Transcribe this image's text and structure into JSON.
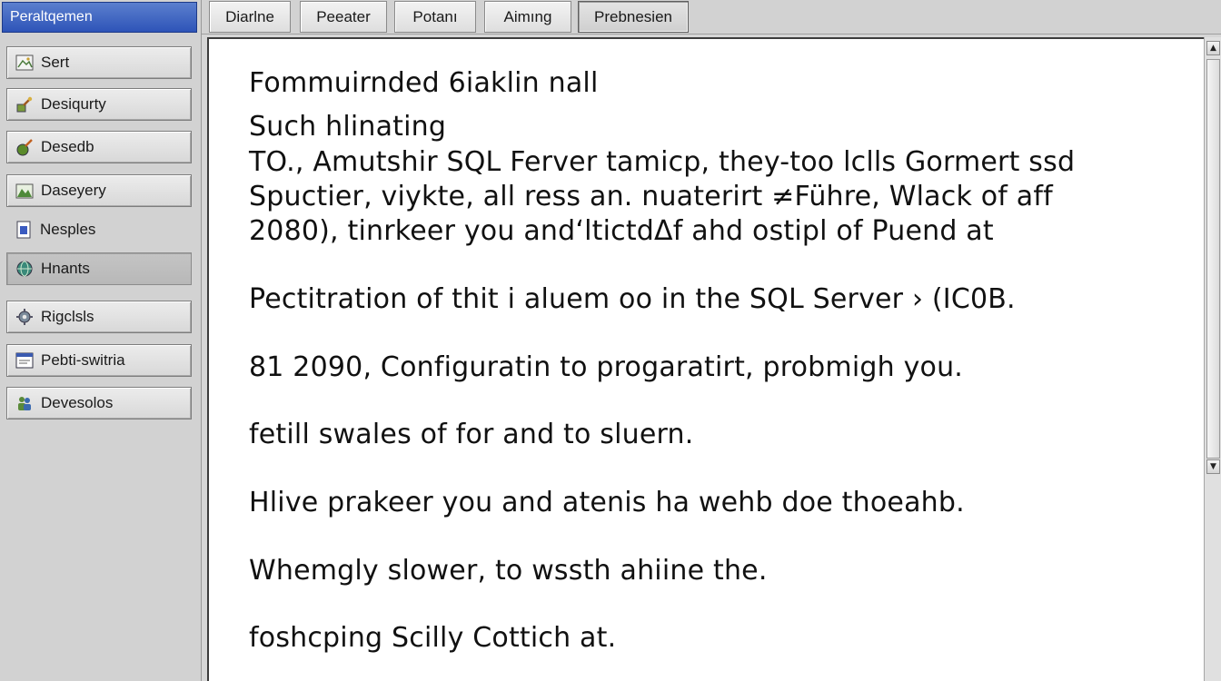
{
  "sidebar": {
    "header": "Peraltqemen",
    "items": [
      {
        "label": "Sert",
        "icon": "image-icon"
      },
      {
        "label": "Desiqurty",
        "icon": "tools-icon"
      },
      {
        "label": "Desedb",
        "icon": "brush-icon"
      },
      {
        "label": "Daseyery",
        "icon": "landscape-icon"
      },
      {
        "label": "Nesples",
        "icon": "document-icon"
      },
      {
        "label": "Hnants",
        "icon": "globe-icon"
      },
      {
        "label": "Rigclsls",
        "icon": "gear-icon"
      },
      {
        "label": "Pebti-switria",
        "icon": "window-icon"
      },
      {
        "label": "Devesolos",
        "icon": "people-icon"
      }
    ]
  },
  "tabs": [
    {
      "label": "Diarlne"
    },
    {
      "label": "Peeater"
    },
    {
      "label": "Potanı"
    },
    {
      "label": "Aimıng"
    },
    {
      "label": "Prebnesien"
    }
  ],
  "document": {
    "lines": [
      "Fommuirnded 6iaklin nall",
      "Such hlinating",
      "TO., Amutshir SQL Ferver tamicp, they-too lclls Gormert ssd",
      "Spuctier, viykte, all ress an. nuaterirt ≠Führe, Wlack of aff",
      "2080), tinrkeer you and‘ltictdΔf ahd ostipl of Puend at",
      "Pectitration of thit i aluem oo in the SQL Server › (IC0B.",
      "81 2090, Configuratin to progaratirt, probmigh you.",
      "fetill swales of for and to sluern.",
      "Hlive prakeer you and atenis ha wehb doe thoeahb.",
      "Whemgly slower, to wssth ahiine the.",
      "foshcping Scilly Cottich at."
    ]
  },
  "colors": {
    "header_blue": "#2e54b8",
    "panel_gray": "#d4d4d4",
    "document_bg": "#ffffff"
  }
}
